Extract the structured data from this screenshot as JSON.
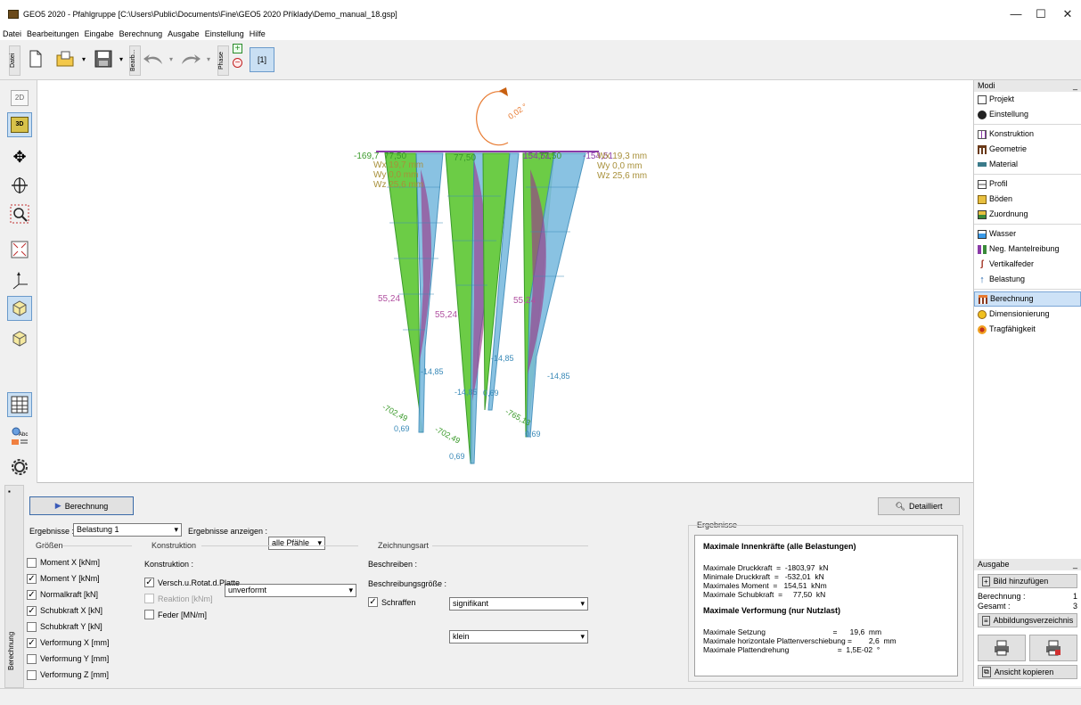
{
  "window": {
    "title": "GEO5 2020 - Pfahlgruppe [C:\\Users\\Public\\Documents\\Fine\\GEO5 2020 Příklady\\Demo_manual_18.gsp]",
    "minimize": "—",
    "maximize": "☐",
    "close": "✕"
  },
  "menu": [
    "Datei",
    "Bearbeitungen",
    "Eingabe",
    "Berechnung",
    "Ausgabe",
    "Einstellung",
    "Hilfe"
  ],
  "toolbar": {
    "datei_tab": "Datei",
    "bearb_tab": "Bearb...",
    "phase_tab": "Phase",
    "phase_number": "[1]"
  },
  "leftbar": {
    "btn_2d": "2D",
    "btn_3d": "3D"
  },
  "viewport": {
    "rotation_label": "0,02 °",
    "top_labels": {
      "a": "-169,7",
      "b": "77,50",
      "c": "77,50",
      "d": "154,51",
      "e": "77,50",
      "f": "-154,51"
    },
    "deform_left": {
      "wx": "Wx 19,7 mm",
      "wy": "Wy 0,0 mm",
      "wz": "Wz 25,6 mm"
    },
    "deform_right": {
      "wx": "Wx 19,3 mm",
      "wy": "Wy 0,0 mm",
      "wz": "Wz 25,6 mm"
    },
    "moment_labels": [
      "55,24",
      "55,24",
      "55,24"
    ],
    "shear_labels": [
      "-14,85",
      "-14,85",
      "-14,85",
      "-14,85"
    ],
    "normal_labels": [
      "-702,49",
      "-702,49",
      "-765,13"
    ],
    "deform_bottom": [
      "0,69",
      "0,69",
      "0,69",
      "0,69"
    ]
  },
  "modes": {
    "header": "Modi",
    "items": [
      "Projekt",
      "Einstellung",
      "Konstruktion",
      "Geometrie",
      "Material",
      "Profil",
      "Böden",
      "Zuordnung",
      "Wasser",
      "Neg. Mantelreibung",
      "Vertikalfeder",
      "Belastung",
      "Berechnung",
      "Dimensionierung",
      "Tragfähigkeit"
    ],
    "selected": "Berechnung"
  },
  "ausgabe": {
    "header": "Ausgabe",
    "add_picture": "Bild hinzufügen",
    "berechnung_label": "Berechnung :",
    "berechnung_value": "1",
    "gesamt_label": "Gesamt :",
    "gesamt_value": "3",
    "figures_list": "Abbildungsverzeichnis",
    "copy_view": "Ansicht kopieren"
  },
  "bottom": {
    "side_tab": "Berechnung",
    "calc_button": "Berechnung",
    "detail_button": "Detailliert",
    "ergebnisse_label": "Ergebnisse :",
    "ergebnisse_value": "Belastung 1",
    "show_label": "Ergebnisse anzeigen :",
    "show_value": "alle Pfähle",
    "groessen_title": "Größen",
    "groessen": [
      {
        "label": "Moment X [kNm]",
        "checked": false
      },
      {
        "label": "Moment Y [kNm]",
        "checked": true
      },
      {
        "label": "Normalkraft [kN]",
        "checked": true
      },
      {
        "label": "Schubkraft X [kN]",
        "checked": true
      },
      {
        "label": "Schubkraft Y [kN]",
        "checked": false
      },
      {
        "label": "Verformung X [mm]",
        "checked": true
      },
      {
        "label": "Verformung Y [mm]",
        "checked": false
      },
      {
        "label": "Verformung Z [mm]",
        "checked": false
      }
    ],
    "konstruktion_title": "Konstruktion",
    "konstruktion_label": "Konstruktion :",
    "konstruktion_value": "unverformt",
    "versch_label": "Versch.u.Rotat.d.Platte",
    "reaktion_label": "Reaktion [kNm]",
    "feder_label": "Feder [MN/m]",
    "zeichnungsart_title": "Zeichnungsart",
    "beschreiben_label": "Beschreiben :",
    "beschreiben_value": "signifikant",
    "groesse_label": "Beschreibungsgröße :",
    "groesse_value": "klein",
    "schraffen_label": "Schraffen",
    "results_title": "Ergebnisse",
    "results_heading1": "Maximale Innenkräfte (alle Belastungen)",
    "results_lines1": [
      "Maximale Druckkraft  =  -1803,97  kN",
      "Minimale Druckkraft  =   -532,01  kN",
      "Maximales Moment  =   154,51  kNm",
      "Maximale Schubkraft  =     77,50  kN"
    ],
    "results_heading2": "Maximale Verformung (nur Nutzlast)",
    "results_lines2": [
      "Maximale Setzung                                =      19,6  mm",
      "Maximale horizontale Plattenverschiebung =        2,6  mm",
      "Maximale Plattendrehung                       =  1,5E-02  °"
    ]
  }
}
